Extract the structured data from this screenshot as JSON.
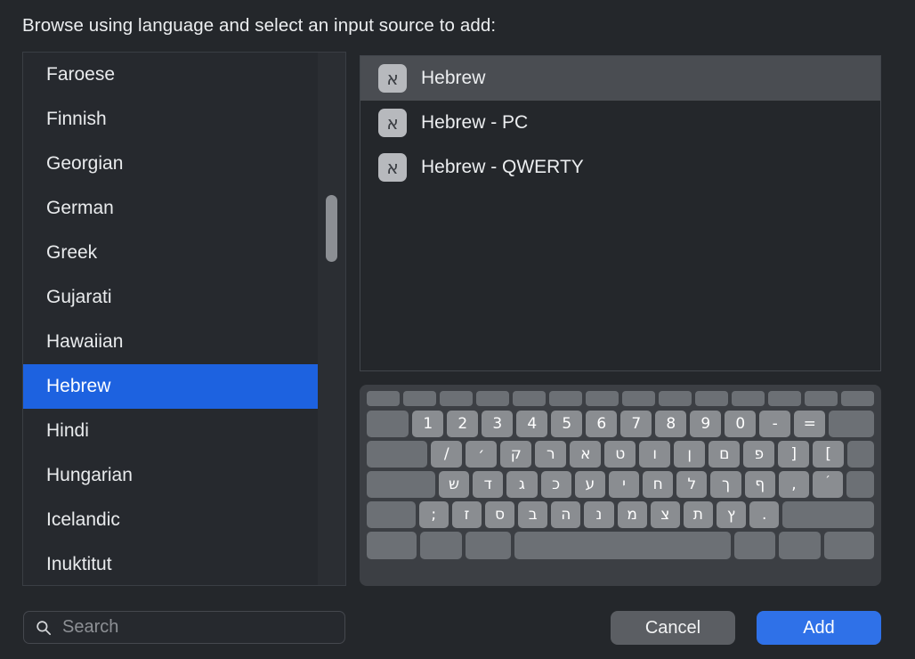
{
  "header": {
    "title": "Browse using language and select an input source to add:"
  },
  "language_list": {
    "items": [
      {
        "label": "Faroese",
        "selected": false
      },
      {
        "label": "Finnish",
        "selected": false
      },
      {
        "label": "Georgian",
        "selected": false
      },
      {
        "label": "German",
        "selected": false
      },
      {
        "label": "Greek",
        "selected": false
      },
      {
        "label": "Gujarati",
        "selected": false
      },
      {
        "label": "Hawaiian",
        "selected": false
      },
      {
        "label": "Hebrew",
        "selected": true
      },
      {
        "label": "Hindi",
        "selected": false
      },
      {
        "label": "Hungarian",
        "selected": false
      },
      {
        "label": "Icelandic",
        "selected": false
      },
      {
        "label": "Inuktitut",
        "selected": false
      }
    ],
    "selected_label": "Hebrew"
  },
  "input_sources": {
    "items": [
      {
        "label": "Hebrew",
        "icon": "aleph-badge-icon",
        "glyph": "א",
        "selected": true
      },
      {
        "label": "Hebrew - PC",
        "icon": "aleph-badge-icon",
        "glyph": "א",
        "selected": false
      },
      {
        "label": "Hebrew - QWERTY",
        "icon": "aleph-badge-icon",
        "glyph": "א",
        "selected": false
      }
    ],
    "selected_label": "Hebrew"
  },
  "keyboard_preview": {
    "layout_name": "Hebrew",
    "rows": [
      {
        "name": "function-row",
        "keys": [
          {
            "label": "",
            "blank": true
          },
          {
            "label": "",
            "blank": true
          },
          {
            "label": "",
            "blank": true
          },
          {
            "label": "",
            "blank": true
          },
          {
            "label": "",
            "blank": true
          },
          {
            "label": "",
            "blank": true
          },
          {
            "label": "",
            "blank": true
          },
          {
            "label": "",
            "blank": true
          },
          {
            "label": "",
            "blank": true
          },
          {
            "label": "",
            "blank": true
          },
          {
            "label": "",
            "blank": true
          },
          {
            "label": "",
            "blank": true
          },
          {
            "label": "",
            "blank": true
          },
          {
            "label": "",
            "blank": true
          }
        ]
      },
      {
        "name": "number-row",
        "keys": [
          {
            "label": "",
            "blank": true,
            "flex": 1.35
          },
          {
            "label": "1"
          },
          {
            "label": "2"
          },
          {
            "label": "3"
          },
          {
            "label": "4"
          },
          {
            "label": "5"
          },
          {
            "label": "6"
          },
          {
            "label": "7"
          },
          {
            "label": "8"
          },
          {
            "label": "9"
          },
          {
            "label": "0"
          },
          {
            "label": "-"
          },
          {
            "label": "="
          },
          {
            "label": "",
            "blank": true,
            "flex": 1.45
          }
        ]
      },
      {
        "name": "top-letter-row",
        "keys": [
          {
            "label": "",
            "blank": true,
            "flex": 1.95
          },
          {
            "label": "/"
          },
          {
            "label": "׳"
          },
          {
            "label": "ק"
          },
          {
            "label": "ר"
          },
          {
            "label": "א"
          },
          {
            "label": "ט"
          },
          {
            "label": "ו"
          },
          {
            "label": "ן"
          },
          {
            "label": "ם"
          },
          {
            "label": "פ"
          },
          {
            "label": "]"
          },
          {
            "label": "["
          },
          {
            "label": "",
            "blank": true,
            "flex": 0.85
          }
        ]
      },
      {
        "name": "home-letter-row",
        "keys": [
          {
            "label": "",
            "blank": true,
            "flex": 2.25
          },
          {
            "label": "ש"
          },
          {
            "label": "ד"
          },
          {
            "label": "ג"
          },
          {
            "label": "כ"
          },
          {
            "label": "ע"
          },
          {
            "label": "י"
          },
          {
            "label": "ח"
          },
          {
            "label": "ל"
          },
          {
            "label": "ך"
          },
          {
            "label": "ף"
          },
          {
            "label": ","
          },
          {
            "label": "׳",
            "superscript": true
          },
          {
            "label": "",
            "blank": true,
            "flex": 0.9
          }
        ]
      },
      {
        "name": "bottom-letter-row",
        "keys": [
          {
            "label": "",
            "blank": true,
            "flex": 1.65
          },
          {
            "label": ";"
          },
          {
            "label": "ז"
          },
          {
            "label": "ס"
          },
          {
            "label": "ב"
          },
          {
            "label": "ה"
          },
          {
            "label": "נ"
          },
          {
            "label": "מ"
          },
          {
            "label": "צ"
          },
          {
            "label": "ת"
          },
          {
            "label": "ץ"
          },
          {
            "label": "."
          },
          {
            "label": "",
            "blank": true,
            "flex": 3.1
          }
        ]
      },
      {
        "name": "modifier-row",
        "keys": [
          {
            "label": "",
            "blank": true,
            "flex": 1.2
          },
          {
            "label": "",
            "blank": true,
            "flex": 1.0
          },
          {
            "label": "",
            "blank": true,
            "flex": 1.1
          },
          {
            "label": "",
            "blank": true,
            "flex": 5.2
          },
          {
            "label": "",
            "blank": true,
            "flex": 1.0
          },
          {
            "label": "",
            "blank": true,
            "flex": 1.0
          },
          {
            "label": "",
            "blank": true,
            "flex": 1.2
          }
        ]
      }
    ]
  },
  "search": {
    "icon": "search-icon",
    "placeholder": "Search",
    "value": ""
  },
  "footer": {
    "cancel_label": "Cancel",
    "add_label": "Add"
  },
  "colors": {
    "accent_blue": "#1d62e0",
    "add_button_blue": "#2f71e8",
    "panel_bg": "#24272b",
    "list_bg": "#26292e",
    "key_face": "#8a8d91"
  }
}
